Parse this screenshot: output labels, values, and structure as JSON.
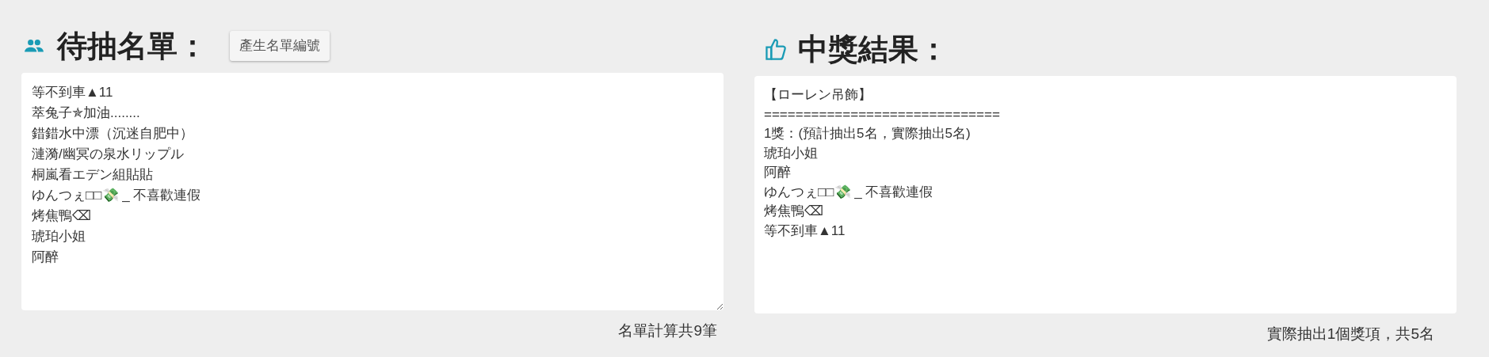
{
  "candidates": {
    "title": "待抽名單：",
    "button": "產生名單編號",
    "entries": [
      "等不到車▲11",
      "萃兔子✯加油........",
      "錯錯水中漂（沉迷自肥中）",
      "漣漪/幽冥の泉水リップル",
      "桐嵐看エデン組貼貼",
      "ゆんつぇ□□💸 _ 不喜歡連假",
      "烤焦鴨⌫",
      "琥珀小姐",
      "阿醉"
    ],
    "count": "名單計算共9筆"
  },
  "results": {
    "title": "中獎結果：",
    "lines": [
      "【ローレン吊飾】",
      "==============================",
      "1獎：(預計抽出5名，實際抽出5名)",
      "琥珀小姐",
      "阿醉",
      "ゆんつぇ□□💸 _ 不喜歡連假",
      "烤焦鴨⌫",
      "等不到車▲11"
    ],
    "summary": "實際抽出1個獎項，共5名"
  }
}
